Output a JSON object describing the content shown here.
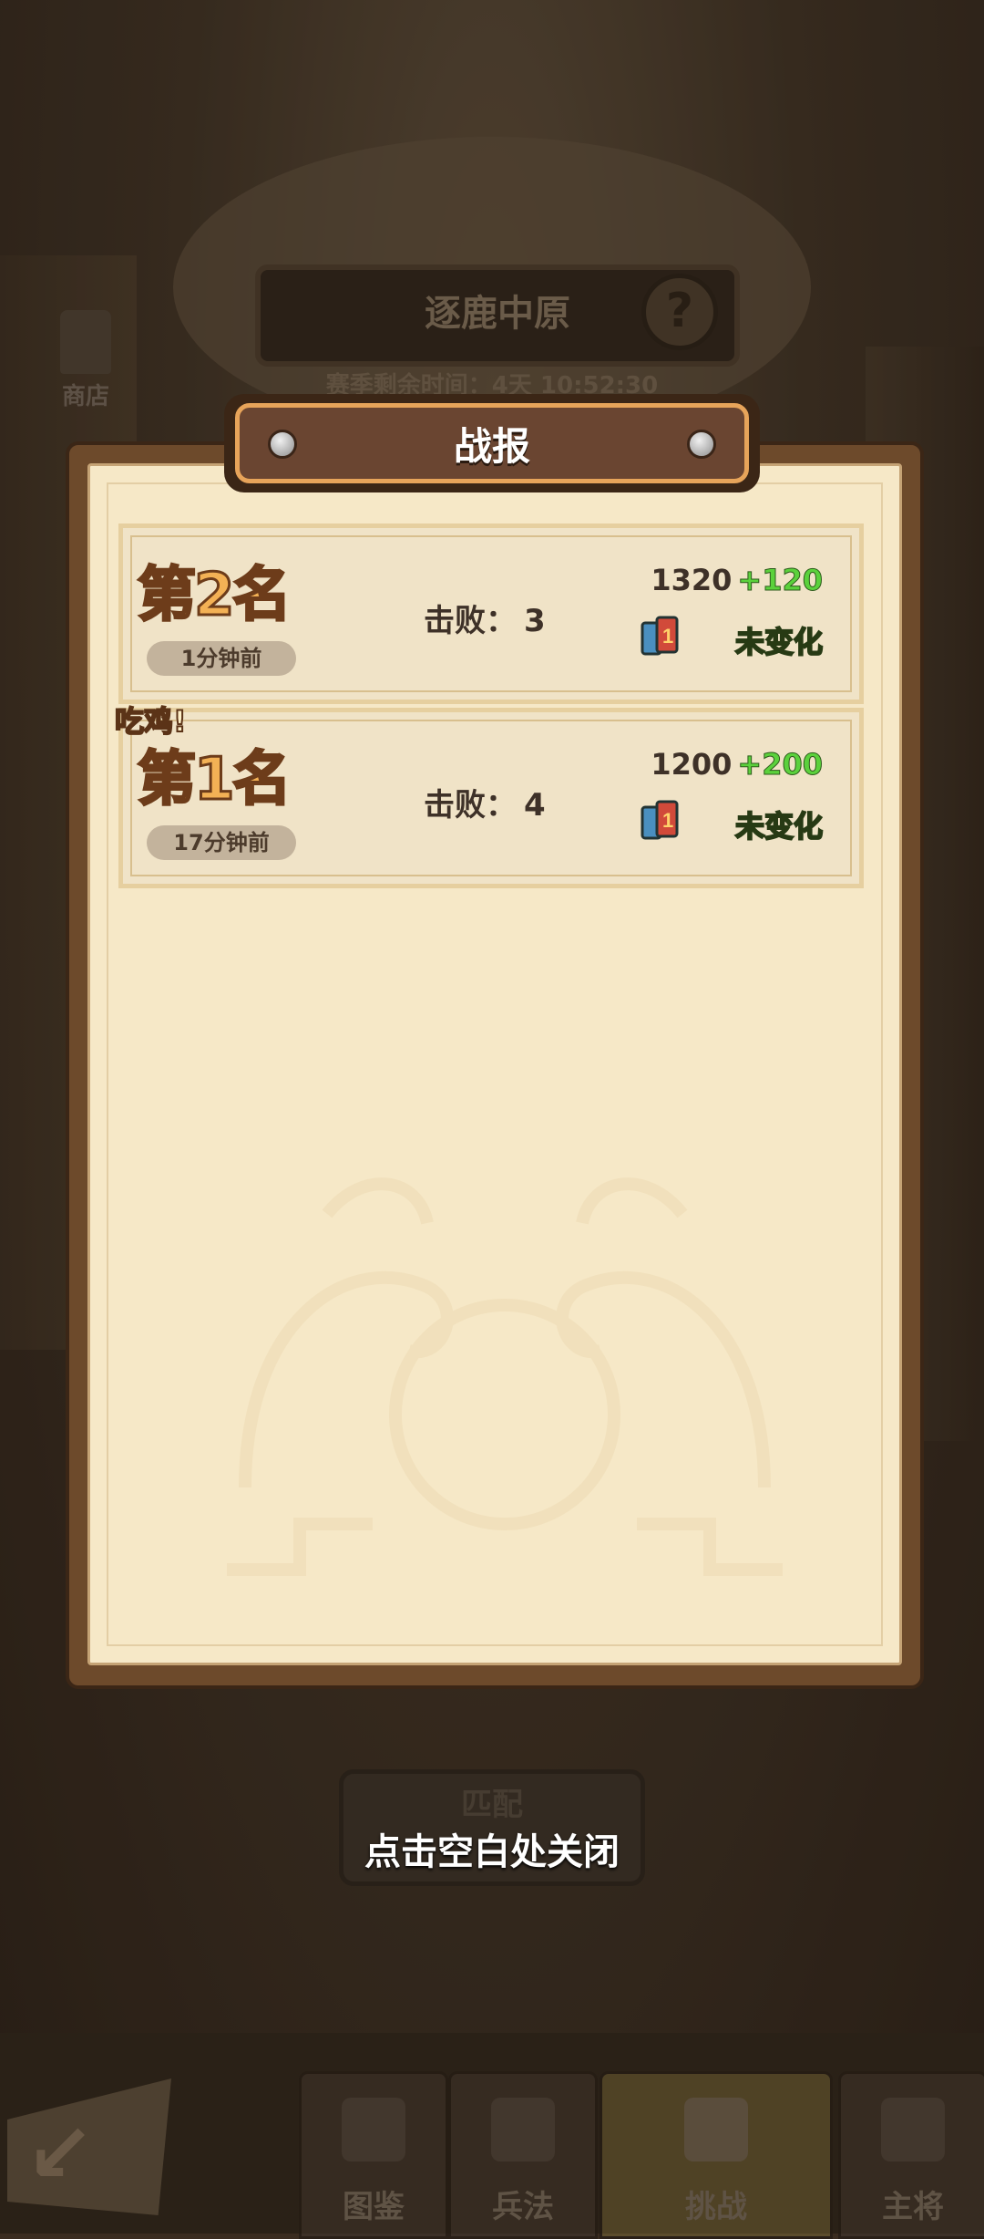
{
  "background": {
    "mode_title": "逐鹿中原",
    "timer_text": "赛季剩余时间：4天 10:52:30",
    "shop_label": "商店",
    "match_label": "匹配"
  },
  "bottom_nav": {
    "tabs": [
      {
        "label": "图鉴",
        "icon": "tent-icon"
      },
      {
        "label": "兵法",
        "icon": "scroll-icon"
      },
      {
        "label": "挑战",
        "icon": "crossed-swords-icon",
        "active": true
      },
      {
        "label": "主将",
        "icon": "general-icon"
      }
    ]
  },
  "panel": {
    "title": "战报",
    "reports": [
      {
        "rank": "第2名",
        "time": "1分钟前",
        "kills_label": "击败：",
        "kills": "3",
        "score": "1320",
        "delta": "+120",
        "rank_change": "未变化"
      },
      {
        "rank": "第1名",
        "time": "17分钟前",
        "kills_label": "击败：",
        "kills": "4",
        "score": "1200",
        "delta": "+200",
        "rank_change": "未变化",
        "tag": "吃鸡!"
      }
    ]
  },
  "close_hint": "点击空白处关闭",
  "colors": {
    "panel_bg": "#f6e8c7",
    "delta_green": "#5bd13c",
    "rank_gold": "#f3b155"
  }
}
